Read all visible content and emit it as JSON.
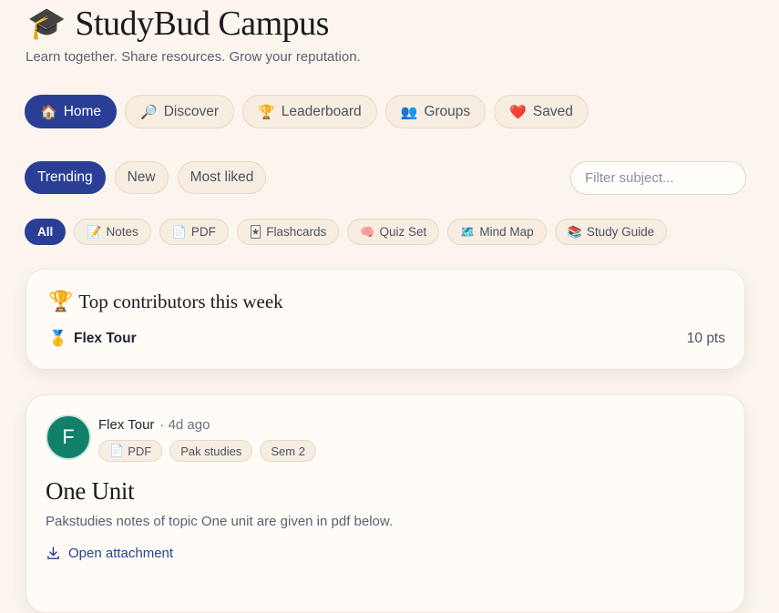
{
  "brand": {
    "logo_icon": "🎓",
    "title": "StudyBud Campus",
    "tagline": "Learn together. Share resources. Grow your reputation."
  },
  "nav": [
    {
      "icon": "🏠",
      "label": "Home",
      "active": true
    },
    {
      "icon": "🔎",
      "label": "Discover"
    },
    {
      "icon": "🏆",
      "label": "Leaderboard"
    },
    {
      "icon": "👥",
      "label": "Groups"
    },
    {
      "icon": "❤️",
      "label": "Saved"
    }
  ],
  "sort": [
    {
      "label": "Trending",
      "active": true
    },
    {
      "label": "New"
    },
    {
      "label": "Most liked"
    }
  ],
  "filter": {
    "placeholder": "Filter subject..."
  },
  "types": [
    {
      "icon": "",
      "label": "All",
      "active": true
    },
    {
      "icon": "📝",
      "label": "Notes"
    },
    {
      "icon": "📄",
      "label": "PDF"
    },
    {
      "icon": "🃏",
      "label": "Flashcards"
    },
    {
      "icon": "🧠",
      "label": "Quiz Set"
    },
    {
      "icon": "🗺️",
      "label": "Mind Map"
    },
    {
      "icon": "📚",
      "label": "Study Guide"
    }
  ],
  "top_contributors": {
    "icon": "🏆",
    "title": "Top contributors this week",
    "entries": [
      {
        "medal": "🥇",
        "name": "Flex Tour",
        "points": "10 pts"
      }
    ]
  },
  "post": {
    "avatar_initial": "F",
    "author": "Flex Tour",
    "time": "· 4d ago",
    "tags": [
      {
        "icon": "📄",
        "label": "PDF"
      },
      {
        "icon": "",
        "label": "Pak studies"
      },
      {
        "icon": "",
        "label": "Sem 2"
      }
    ],
    "title": "One Unit",
    "body": "Pakstudies notes of topic One unit are given in pdf below.",
    "attachment_label": "Open attachment"
  },
  "colors": {
    "accent": "#2a3e96",
    "background": "#fbf5ee",
    "avatar": "#11806a"
  }
}
